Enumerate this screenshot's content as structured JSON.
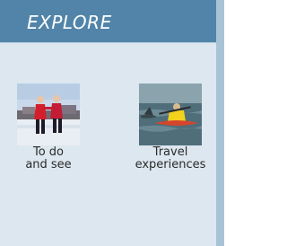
{
  "header": {
    "title": "EXPLORE",
    "bg_color": "#5184a8",
    "panel_color": "#dce7ef"
  },
  "tiles": [
    {
      "label": "To do\nand see",
      "image_icon": "skaters-photo"
    },
    {
      "label": "Travel\nexperiences",
      "image_icon": "kayak-photo"
    }
  ]
}
